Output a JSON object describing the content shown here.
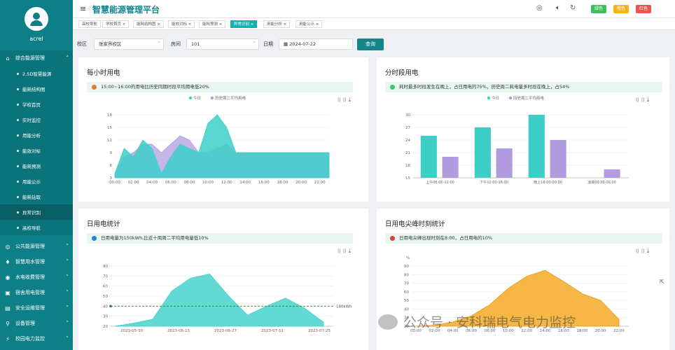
{
  "user": {
    "name": "acrel"
  },
  "app": {
    "title": "智慧能源管理平台"
  },
  "topbar": {
    "btn1": "绿色",
    "btn2": "橙色",
    "btn3": "红色"
  },
  "menu_groups": {
    "g1": "综合能源管理",
    "g2": "公共能源管理",
    "g3": "智慧用水管理",
    "g4": "水电收费管理",
    "g5": "宿舍用电管理",
    "g6": "安全运维管理",
    "g7": "设备管理",
    "g8": "校园电力监控"
  },
  "submenu": [
    "2.5D智慧能源",
    "能耗结构图",
    "学校首页",
    "实时监控",
    "用能分析",
    "能效对标",
    "能耗预测",
    "用能公示",
    "能耗钻取",
    "异常识别",
    "高校导航"
  ],
  "tabs": [
    "高校导航",
    "学校首页",
    "能耗结构图",
    "能效对标",
    "能耗预测",
    "异常识别",
    "用能分析",
    "用能公示"
  ],
  "filter": {
    "campus_label": "校区",
    "campus_value": "张家界校区",
    "room_label": "房间",
    "room_value": "101",
    "date_label": "日期",
    "date_value": "2024-07-22",
    "query": "查询"
  },
  "colors": {
    "teal": "#3ccfc8",
    "purple": "#b19ce0",
    "orange": "#f6b33c",
    "sidebar": "#0e7f87",
    "active_tab": "#14b1b1"
  },
  "cards": {
    "hourly": {
      "title": "每小时用电",
      "info": "15:00~16:00的用电比历史同期时段平均用电低20%"
    },
    "period": {
      "title": "分时段用电",
      "info": "耗时最多时段发生在晚上，占日用电的75%，历史周二耗电量多时段在晚上，占54%"
    },
    "daily": {
      "title": "日用电统计",
      "info": "日用电量为150kWh,比近十周周二平均用电量低10%"
    },
    "peak": {
      "title": "日用电尖峰时刻统计",
      "info": "日用电尖峰出现时刻在8:00，占日用电的10%"
    }
  },
  "watermark": "公众号 · 安科瑞电气电力监控",
  "chart_data": [
    {
      "type": "area",
      "legend": [
        "今日",
        "历史周二平均用电"
      ],
      "x": [
        "00:00",
        "01:00",
        "02:00",
        "03:00",
        "04:00",
        "05:00",
        "06:00",
        "07:00",
        "08:00",
        "09:00",
        "10:00",
        "11:00",
        "12:00",
        "13:00",
        "14:00",
        "15:00",
        "16:00",
        "17:00",
        "18:00",
        "19:00",
        "20:00",
        "21:00",
        "22:00",
        "23:00"
      ],
      "x_ticks": [
        "00:00",
        "02:00",
        "04:00",
        "06:00",
        "08:00",
        "10:00",
        "12:00",
        "14:00",
        "16:00",
        "18:00",
        "20:00",
        "22:00"
      ],
      "series": [
        {
          "name": "今日",
          "values": [
            4,
            10,
            8,
            12,
            10,
            4,
            8,
            11,
            10,
            9,
            16,
            18,
            15,
            9,
            9,
            9,
            9,
            9,
            9,
            9,
            9,
            9,
            9,
            9
          ]
        },
        {
          "name": "历史周二平均用电",
          "values": [
            4,
            8,
            9,
            11,
            11,
            9,
            11,
            13,
            12,
            9,
            9,
            10,
            11,
            9,
            9,
            9,
            9,
            9,
            9,
            9,
            9,
            9,
            9,
            9
          ]
        }
      ],
      "ylim": [
        3,
        18
      ],
      "y_ticks": [
        3,
        6,
        9,
        12,
        15,
        18
      ]
    },
    {
      "type": "bar",
      "legend": [
        "今日",
        "历史周二平均用电"
      ],
      "categories": [
        "上午06:00-12:00",
        "下午12:00-18:00",
        "晚上18:00-00:00",
        "凌晨00:00-06:00"
      ],
      "series": [
        {
          "name": "今日",
          "values": [
            25,
            27,
            30,
            15
          ]
        },
        {
          "name": "历史周二平均用电",
          "values": [
            20,
            22,
            24,
            17
          ]
        }
      ],
      "ylim": [
        15,
        30
      ],
      "y_ticks": [
        15,
        18,
        21,
        24,
        27,
        30
      ]
    },
    {
      "type": "area",
      "x": [
        "2023-05-30",
        "2023-06-13",
        "2023-06-27",
        "2023-07-11",
        "2023-07-25"
      ],
      "points": [
        [
          0,
          20
        ],
        [
          1,
          23
        ],
        [
          2,
          27
        ],
        [
          3,
          55
        ],
        [
          4,
          68
        ],
        [
          5,
          72
        ],
        [
          6,
          50
        ],
        [
          7,
          31
        ],
        [
          8,
          40
        ],
        [
          9,
          48
        ],
        [
          10,
          38
        ],
        [
          11,
          24
        ]
      ],
      "reference_line": {
        "value": 40,
        "label": "180kWh"
      },
      "ylim": [
        20,
        80
      ],
      "y_ticks": [
        20,
        30,
        40,
        50,
        60,
        70,
        80
      ]
    },
    {
      "type": "area",
      "ylabel": "%",
      "x": [
        "00:00",
        "02:00",
        "04:00",
        "06:00",
        "08:00",
        "10:00",
        "12:00",
        "14:00",
        "16:00",
        "18:00",
        "20:00",
        "22:00"
      ],
      "values": [
        20,
        21,
        25,
        32,
        45,
        64,
        78,
        85,
        72,
        58,
        50,
        28
      ],
      "ylim": [
        20,
        90
      ],
      "y_ticks": [
        20,
        30,
        40,
        50,
        60,
        70,
        80,
        90
      ]
    }
  ]
}
